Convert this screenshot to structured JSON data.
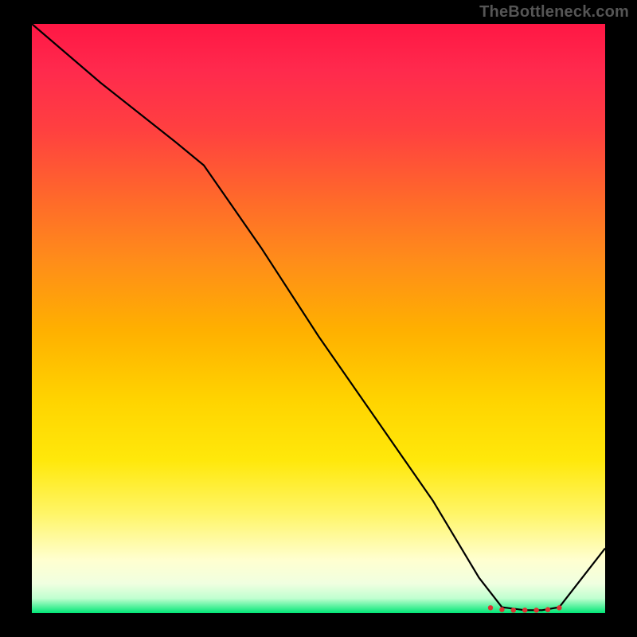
{
  "watermark": "TheBottleneck.com",
  "chart_data": {
    "type": "line",
    "title": "",
    "xlabel": "",
    "ylabel": "",
    "xlim": [
      0,
      100
    ],
    "ylim": [
      0,
      100
    ],
    "x": [
      0,
      12,
      25,
      30,
      40,
      50,
      60,
      70,
      78,
      82,
      86,
      89,
      92,
      100
    ],
    "values": [
      100,
      90,
      80,
      76,
      62,
      47,
      33,
      19,
      6,
      1,
      0.5,
      0.5,
      1,
      11
    ],
    "markers": {
      "x": [
        80,
        82,
        84,
        86,
        88,
        90,
        92
      ],
      "y": [
        0.9,
        0.6,
        0.5,
        0.5,
        0.5,
        0.6,
        0.9
      ],
      "color": "#d33"
    },
    "gradient_stops": [
      {
        "pct": 0,
        "color": "#ff1744"
      },
      {
        "pct": 8,
        "color": "#ff2a4d"
      },
      {
        "pct": 18,
        "color": "#ff4040"
      },
      {
        "pct": 30,
        "color": "#ff6a2a"
      },
      {
        "pct": 40,
        "color": "#ff8c1a"
      },
      {
        "pct": 52,
        "color": "#ffb000"
      },
      {
        "pct": 64,
        "color": "#ffd400"
      },
      {
        "pct": 74,
        "color": "#ffe80a"
      },
      {
        "pct": 83,
        "color": "#fff566"
      },
      {
        "pct": 91,
        "color": "#ffffd0"
      },
      {
        "pct": 95,
        "color": "#f0ffe0"
      },
      {
        "pct": 97.5,
        "color": "#c0ffd0"
      },
      {
        "pct": 100,
        "color": "#00e676"
      }
    ]
  }
}
